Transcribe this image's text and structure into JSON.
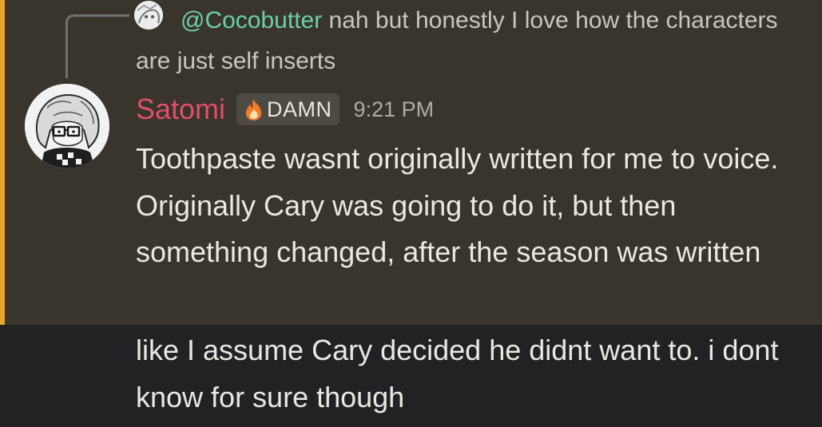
{
  "reply": {
    "mention": "@Cocobutter",
    "text": "nah but honestly I love how the characters are just self inserts"
  },
  "message": {
    "author": "Satomi",
    "author_color": "#e04f6c",
    "tag_icon": "flame-icon",
    "tag": "DAMN",
    "time": "9:21 PM",
    "text": "Toothpaste wasnt originally written for me to voice. Originally Cary was going to do it, but then something changed, after the season was written"
  },
  "caption": {
    "text": "like I assume Cary decided he didnt want to. i dont know for sure though"
  },
  "colors": {
    "highlight_bar": "#e3a72f",
    "mention": "#6bcfa8",
    "highlight_bg": "#39342c",
    "caption_bg": "#222224"
  }
}
